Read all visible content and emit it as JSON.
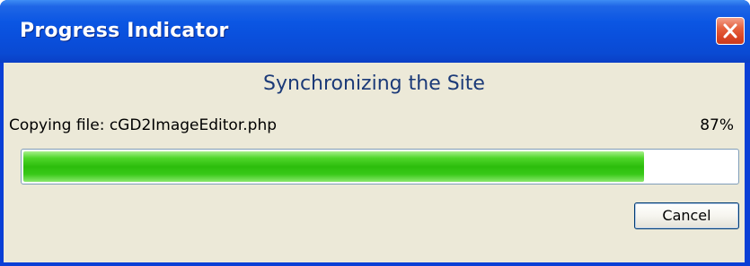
{
  "window": {
    "title": "Progress Indicator"
  },
  "dialog": {
    "heading": "Synchronizing the Site",
    "status_text": "Copying file: cGD2ImageEditor.php",
    "percent_text": "87%",
    "progress_fraction": 0.87,
    "cancel_label": "Cancel"
  },
  "icons": {
    "close": "close-icon"
  },
  "colors": {
    "titlebar": "#0b56e3",
    "heading_text": "#1b3a78",
    "progress_green": "#2cbd0c",
    "client_background": "#ece9d8",
    "close_button": "#e5613d"
  }
}
